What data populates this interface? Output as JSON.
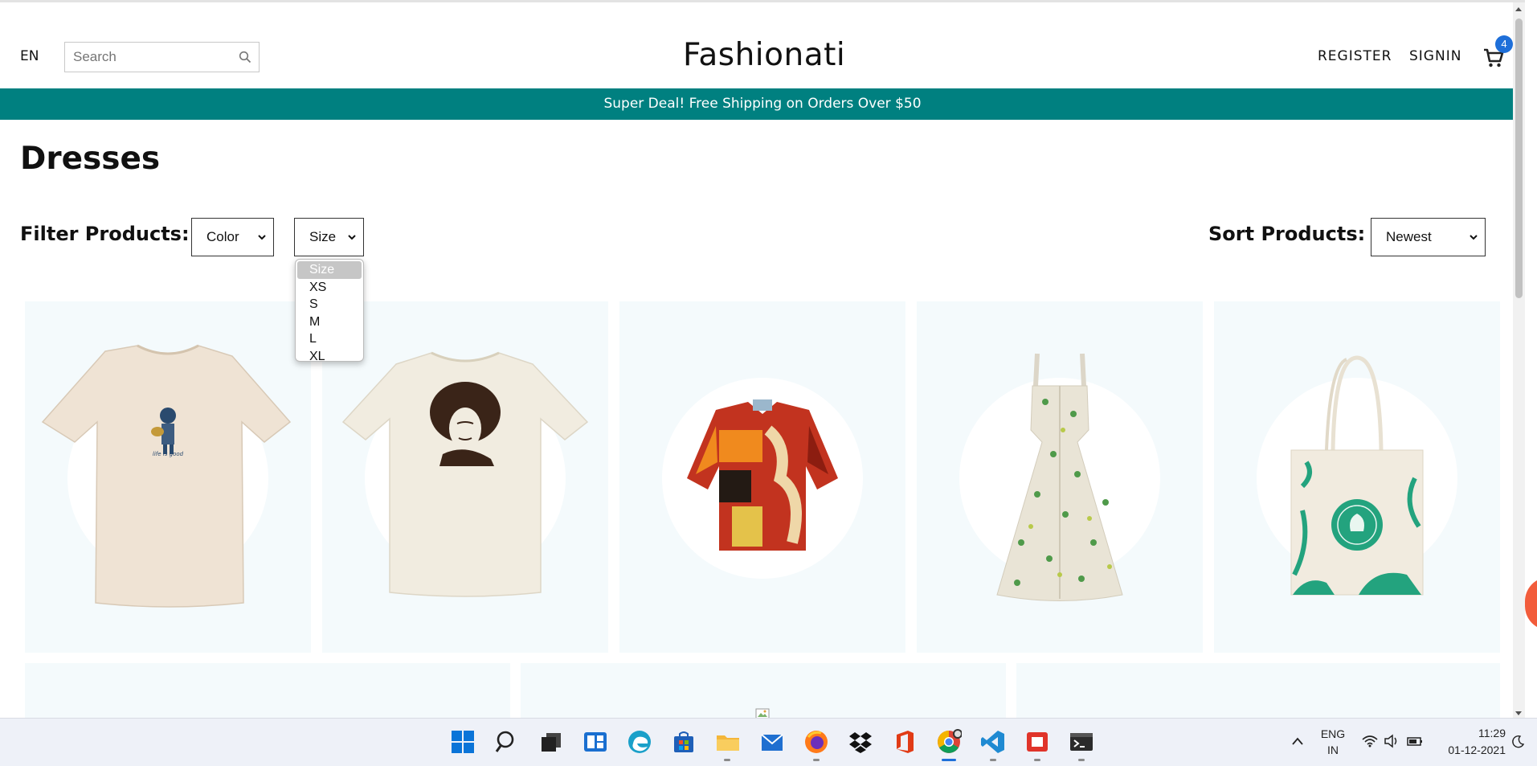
{
  "header": {
    "language": "EN",
    "search_placeholder": "Search",
    "logo": "Fashionati",
    "register_label": "REGISTER",
    "signin_label": "SIGNIN",
    "cart_count": "4"
  },
  "announcement": "Super Deal! Free Shipping on Orders Over $50",
  "page_title": "Dresses",
  "filters": {
    "label": "Filter Products:",
    "color_selected": "Color",
    "size_selected": "Size",
    "size_options": [
      "Size",
      "XS",
      "S",
      "M",
      "L",
      "XL"
    ]
  },
  "sort": {
    "label": "Sort Products:",
    "selected": "Newest"
  },
  "products": [
    {
      "name": "cream t-shirt with guitar player print"
    },
    {
      "name": "off-white t-shirt with portrait print"
    },
    {
      "name": "patterned short-sleeve shirt"
    },
    {
      "name": "floral print sundress"
    },
    {
      "name": "canvas tote bag with green print"
    }
  ],
  "taskbar": {
    "language_line1": "ENG",
    "language_line2": "IN",
    "time": "11:29",
    "date": "01-12-2021",
    "apps": [
      "start",
      "search",
      "task-view",
      "widgets",
      "edge",
      "store",
      "file-explorer",
      "mail",
      "firefox",
      "dropbox",
      "office",
      "chrome",
      "vscode",
      "screen-recorder",
      "terminal"
    ]
  },
  "colors": {
    "announcement_bg": "#008080",
    "product_bg": "#f4fafc",
    "cart_badge": "#1e6fd9"
  }
}
